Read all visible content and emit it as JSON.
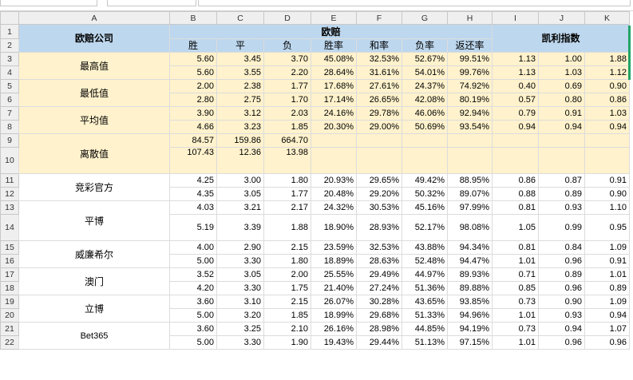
{
  "columns": [
    "A",
    "B",
    "C",
    "D",
    "E",
    "F",
    "G",
    "H",
    "I",
    "J",
    "K"
  ],
  "row_numbers": [
    "1",
    "2",
    "3",
    "4",
    "5",
    "6",
    "7",
    "8",
    "9",
    "10",
    "11",
    "12",
    "13",
    "14",
    "15",
    "16",
    "17",
    "18",
    "19",
    "20",
    "21",
    "22"
  ],
  "header": {
    "company": "欧赔公司",
    "euro_odds": "欧赔",
    "kelly": "凯利指数",
    "sub": [
      "胜",
      "平",
      "负",
      "胜率",
      "和率",
      "负率",
      "返还率"
    ]
  },
  "groups": [
    {
      "label": "最高值",
      "highlight": true,
      "rows": [
        {
          "num": "3",
          "cells": [
            "5.60",
            "3.45",
            "3.70",
            "45.08%",
            "32.53%",
            "52.67%",
            "99.51%",
            "1.13",
            "1.00",
            "1.88"
          ]
        },
        {
          "num": "4",
          "cells": [
            "5.60",
            "3.55",
            "2.20",
            "28.64%",
            "31.61%",
            "54.01%",
            "99.76%",
            "1.13",
            "1.03",
            "1.12"
          ]
        }
      ]
    },
    {
      "label": "最低值",
      "highlight": true,
      "rows": [
        {
          "num": "5",
          "cells": [
            "2.00",
            "2.38",
            "1.77",
            "17.68%",
            "27.61%",
            "24.37%",
            "74.92%",
            "0.40",
            "0.69",
            "0.90"
          ]
        },
        {
          "num": "6",
          "cells": [
            "2.80",
            "2.75",
            "1.70",
            "17.14%",
            "26.65%",
            "42.08%",
            "80.19%",
            "0.57",
            "0.80",
            "0.86"
          ]
        }
      ]
    },
    {
      "label": "平均值",
      "highlight": true,
      "rows": [
        {
          "num": "7",
          "cells": [
            "3.90",
            "3.12",
            "2.03",
            "24.16%",
            "29.78%",
            "46.06%",
            "92.94%",
            "0.79",
            "0.91",
            "1.03"
          ]
        },
        {
          "num": "8",
          "cells": [
            "4.66",
            "3.23",
            "1.85",
            "20.30%",
            "29.00%",
            "50.69%",
            "93.54%",
            "0.94",
            "0.94",
            "0.94"
          ]
        }
      ]
    },
    {
      "label": "离散值",
      "highlight": true,
      "rows": [
        {
          "num": "9",
          "cells": [
            "84.57",
            "159.86",
            "664.70",
            "",
            "",
            "",
            "",
            "",
            "",
            ""
          ]
        },
        {
          "num": "10",
          "tall": true,
          "cells": [
            "107.43",
            "12.36",
            "13.98",
            "",
            "",
            "",
            "",
            "",
            "",
            ""
          ]
        }
      ]
    },
    {
      "label": "竞彩官方",
      "highlight": false,
      "rows": [
        {
          "num": "11",
          "cells": [
            "4.25",
            "3.00",
            "1.80",
            "20.93%",
            "29.65%",
            "49.42%",
            "88.95%",
            "0.86",
            "0.87",
            "0.91"
          ]
        },
        {
          "num": "12",
          "cells": [
            "4.35",
            "3.05",
            "1.77",
            "20.48%",
            "29.20%",
            "50.32%",
            "89.07%",
            "0.88",
            "0.89",
            "0.90"
          ]
        }
      ]
    },
    {
      "label": "平博",
      "highlight": false,
      "rows": [
        {
          "num": "13",
          "cells": [
            "4.03",
            "3.21",
            "2.17",
            "24.32%",
            "30.53%",
            "45.16%",
            "97.99%",
            "0.81",
            "0.93",
            "1.10"
          ]
        },
        {
          "num": "14",
          "tall": true,
          "cells": [
            "5.19",
            "3.39",
            "1.88",
            "18.90%",
            "28.93%",
            "52.17%",
            "98.08%",
            "1.05",
            "0.99",
            "0.95"
          ]
        }
      ]
    },
    {
      "label": "威廉希尔",
      "highlight": false,
      "rows": [
        {
          "num": "15",
          "cells": [
            "4.00",
            "2.90",
            "2.15",
            "23.59%",
            "32.53%",
            "43.88%",
            "94.34%",
            "0.81",
            "0.84",
            "1.09"
          ]
        },
        {
          "num": "16",
          "cells": [
            "5.00",
            "3.30",
            "1.80",
            "18.89%",
            "28.63%",
            "52.48%",
            "94.47%",
            "1.01",
            "0.96",
            "0.91"
          ]
        }
      ]
    },
    {
      "label": "澳门",
      "highlight": false,
      "rows": [
        {
          "num": "17",
          "cells": [
            "3.52",
            "3.05",
            "2.00",
            "25.55%",
            "29.49%",
            "44.97%",
            "89.93%",
            "0.71",
            "0.89",
            "1.01"
          ]
        },
        {
          "num": "18",
          "cells": [
            "4.20",
            "3.30",
            "1.75",
            "21.40%",
            "27.24%",
            "51.36%",
            "89.88%",
            "0.85",
            "0.96",
            "0.89"
          ]
        }
      ]
    },
    {
      "label": "立博",
      "highlight": false,
      "rows": [
        {
          "num": "19",
          "cells": [
            "3.60",
            "3.10",
            "2.15",
            "26.07%",
            "30.28%",
            "43.65%",
            "93.85%",
            "0.73",
            "0.90",
            "1.09"
          ]
        },
        {
          "num": "20",
          "cells": [
            "5.00",
            "3.20",
            "1.85",
            "18.99%",
            "29.68%",
            "51.33%",
            "94.96%",
            "1.01",
            "0.93",
            "0.94"
          ]
        }
      ]
    },
    {
      "label": "Bet365",
      "highlight": false,
      "small": true,
      "rows": [
        {
          "num": "21",
          "cells": [
            "3.60",
            "3.25",
            "2.10",
            "26.16%",
            "28.98%",
            "44.85%",
            "94.19%",
            "0.73",
            "0.94",
            "1.07"
          ]
        },
        {
          "num": "22",
          "cells": [
            "5.00",
            "3.30",
            "1.90",
            "19.43%",
            "29.44%",
            "51.13%",
            "97.15%",
            "1.01",
            "0.96",
            "0.96"
          ]
        }
      ]
    }
  ]
}
